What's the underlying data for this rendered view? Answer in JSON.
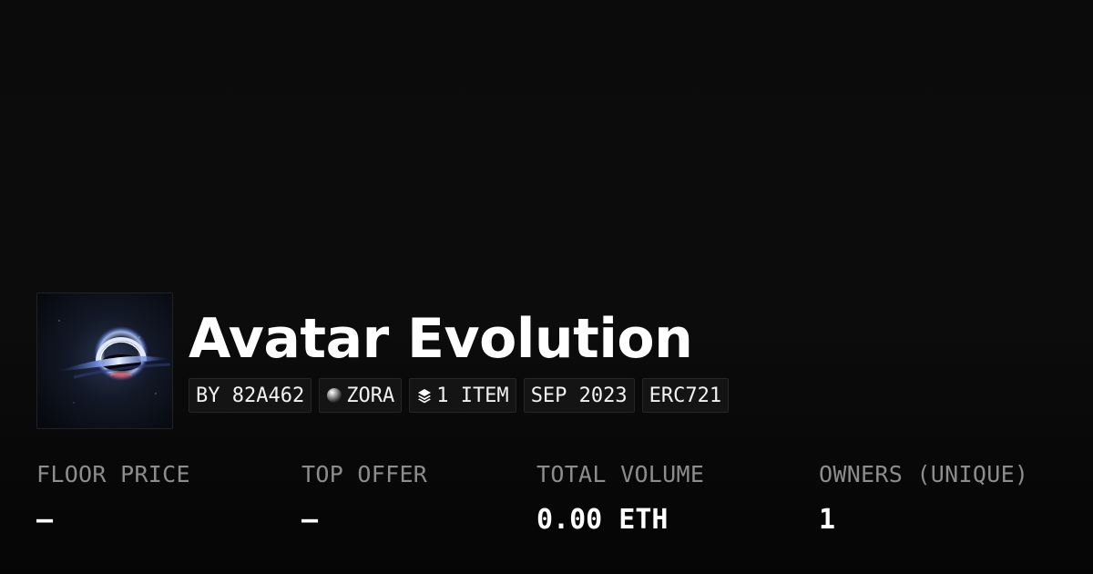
{
  "collection": {
    "title": "Avatar Evolution",
    "thumbnail_icon": "black-hole-artwork",
    "badges": {
      "creator": "BY 82A462",
      "chain": "ZORA",
      "chain_icon": "zora-orb-icon",
      "items": "1 ITEM",
      "items_icon": "layers-icon",
      "date": "SEP 2023",
      "standard": "ERC721"
    }
  },
  "stats": [
    {
      "label": "FLOOR PRICE",
      "value": "–"
    },
    {
      "label": "TOP OFFER",
      "value": "–"
    },
    {
      "label": "TOTAL VOLUME",
      "value": "0.00 ETH"
    },
    {
      "label": "OWNERS (UNIQUE)",
      "value": "1"
    }
  ],
  "colors": {
    "background": "#0a0a0a",
    "text": "#ffffff",
    "muted": "#8d8d8d",
    "badge_bg": "#141414",
    "badge_border": "#262626"
  }
}
